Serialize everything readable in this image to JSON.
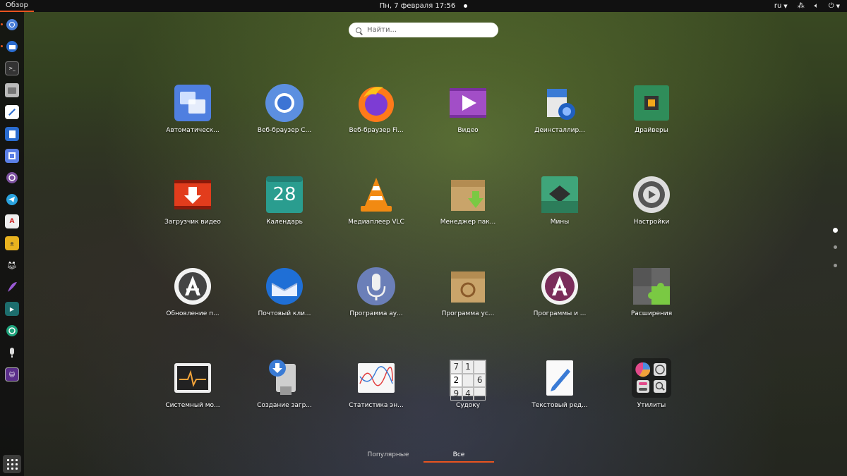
{
  "topbar": {
    "activities": "Обзор",
    "clock": "Пн, 7 февраля  17:56",
    "lang": "ru"
  },
  "search": {
    "placeholder": "Найти..."
  },
  "apps": [
    {
      "label": "Автоматическ...",
      "icon": "overlapping-squares-icon"
    },
    {
      "label": "Веб-браузер C...",
      "icon": "chromium-icon"
    },
    {
      "label": "Веб-браузер Fi...",
      "icon": "firefox-icon"
    },
    {
      "label": "Видео",
      "icon": "video-player-icon"
    },
    {
      "label": "Деинсталлир...",
      "icon": "uninstaller-icon"
    },
    {
      "label": "Драйверы",
      "icon": "chip-icon"
    },
    {
      "label": "Загрузчик видео",
      "icon": "video-download-icon"
    },
    {
      "label": "Календарь",
      "icon": "calendar-icon",
      "text": "28"
    },
    {
      "label": "Медиаплеер VLC",
      "icon": "vlc-cone-icon"
    },
    {
      "label": "Менеджер пак...",
      "icon": "package-box-icon"
    },
    {
      "label": "Мины",
      "icon": "mines-icon"
    },
    {
      "label": "Настройки",
      "icon": "settings-gear-icon"
    },
    {
      "label": "Обновление п...",
      "icon": "software-updater-icon"
    },
    {
      "label": "Почтовый кли...",
      "icon": "thunderbird-icon"
    },
    {
      "label": "Программа ау...",
      "icon": "microphone-icon"
    },
    {
      "label": "Программа ус...",
      "icon": "debian-package-icon"
    },
    {
      "label": "Программы и ...",
      "icon": "software-center-icon"
    },
    {
      "label": "Расширения",
      "icon": "puzzle-icon"
    },
    {
      "label": "Системный мо...",
      "icon": "system-monitor-icon"
    },
    {
      "label": "Создание загр...",
      "icon": "usb-creator-icon"
    },
    {
      "label": "Статистика эн...",
      "icon": "power-stats-icon"
    },
    {
      "label": "Судоку",
      "icon": "sudoku-icon",
      "text": [
        "7",
        "1",
        "",
        "2",
        "",
        "6",
        "9",
        "4",
        ""
      ]
    },
    {
      "label": "Текстовый ред...",
      "icon": "text-editor-icon"
    },
    {
      "label": "Утилиты",
      "icon": "utilities-folder-icon"
    }
  ],
  "tabs": [
    {
      "label": "Популярные",
      "active": false
    },
    {
      "label": "Все",
      "active": true
    }
  ]
}
